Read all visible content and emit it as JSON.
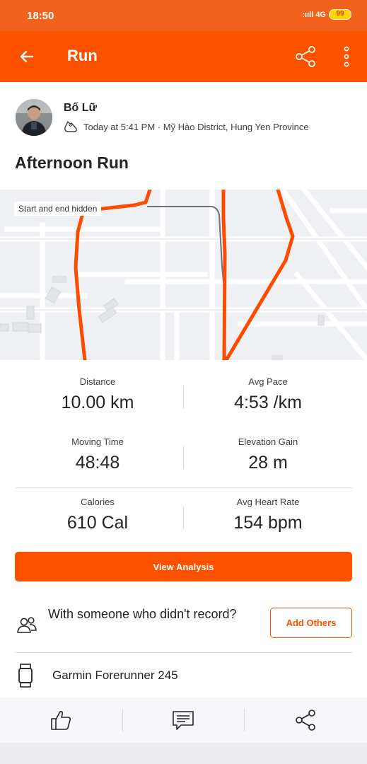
{
  "status_bar": {
    "time": "18:50",
    "signal": ":ııll 4G",
    "battery": "99"
  },
  "app_bar": {
    "title": "Run",
    "back_icon": "arrow-left-icon",
    "share_icon": "share-icon",
    "more_icon": "more-vertical-icon"
  },
  "athlete": {
    "name": "Bố Lữ",
    "meta": "Today at 5:41 PM · Mỹ Hào District, Hung Yen Province",
    "activity_icon": "shoe-icon"
  },
  "activity": {
    "title": "Afternoon Run"
  },
  "map": {
    "label": "Start and end hidden",
    "route_color": "#fc4c02"
  },
  "stats": [
    {
      "label": "Distance",
      "value": "10.00 km"
    },
    {
      "label": "Avg Pace",
      "value": "4:53 /km"
    },
    {
      "label": "Moving Time",
      "value": "48:48"
    },
    {
      "label": "Elevation Gain",
      "value": "28 m"
    },
    {
      "label": "Calories",
      "value": "610 Cal"
    },
    {
      "label": "Avg Heart Rate",
      "value": "154 bpm"
    }
  ],
  "actions": {
    "view_analysis": "View Analysis",
    "with_others_text": "With someone who didn't record?",
    "add_others": "Add Others"
  },
  "device": {
    "name": "Garmin Forerunner 245",
    "icon": "watch-icon"
  },
  "bottom_bar": {
    "kudos_icon": "thumbs-up-icon",
    "comment_icon": "comment-icon",
    "share_icon": "share-icon"
  },
  "colors": {
    "accent": "#fc5200",
    "status_bar": "#f1621d"
  }
}
